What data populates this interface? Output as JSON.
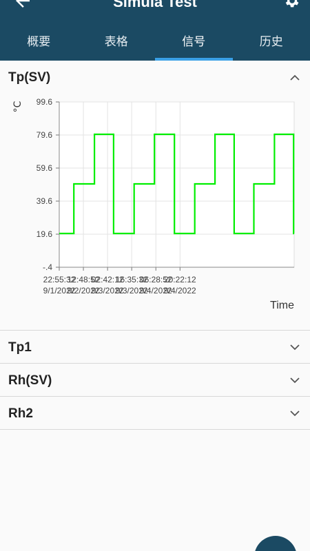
{
  "app": {
    "title": "Simula Test"
  },
  "tabs": [
    {
      "label": "概要",
      "active": false
    },
    {
      "label": "表格",
      "active": false
    },
    {
      "label": "信号",
      "active": true
    },
    {
      "label": "历史",
      "active": false
    }
  ],
  "sections": [
    {
      "title": "Tp(SV)",
      "expanded": true
    },
    {
      "title": "Tp1",
      "expanded": false
    },
    {
      "title": "Rh(SV)",
      "expanded": false
    },
    {
      "title": "Rh2",
      "expanded": false
    }
  ],
  "colors": {
    "appbar": "#1b4a63",
    "tab_indicator": "#3aa0e6",
    "line": "#00ee00"
  },
  "chart_data": {
    "type": "line",
    "ylabel": "°C",
    "xlabel": "Time",
    "y_ticks": [
      "99.6",
      "79.6",
      "59.6",
      "39.6",
      "19.6",
      "-.4"
    ],
    "ylim": [
      -0.4,
      99.6
    ],
    "x_ticks": [
      {
        "time": "22:55:32",
        "date": "9/1/2022"
      },
      {
        "time": "12:48:52",
        "date": "9/2/2022"
      },
      {
        "time": "02:42:12",
        "date": "9/3/2022"
      },
      {
        "time": "16:35:32",
        "date": "9/3/2022"
      },
      {
        "time": "06:28:52",
        "date": "9/4/2022"
      },
      {
        "time": "20:22:12",
        "date": "9/4/2022"
      }
    ],
    "series": [
      {
        "color": "#00ee00",
        "points": [
          [
            "2022-09-01 22:55",
            20
          ],
          [
            "2022-09-02 07:20",
            20
          ],
          [
            "2022-09-02 07:20",
            50
          ],
          [
            "2022-09-02 19:10",
            50
          ],
          [
            "2022-09-02 19:10",
            80
          ],
          [
            "2022-09-03 06:10",
            80
          ],
          [
            "2022-09-03 06:10",
            20
          ],
          [
            "2022-09-03 18:00",
            20
          ],
          [
            "2022-09-03 18:00",
            50
          ],
          [
            "2022-09-04 05:40",
            50
          ],
          [
            "2022-09-04 05:40",
            80
          ],
          [
            "2022-09-04 17:10",
            80
          ],
          [
            "2022-09-04 17:10",
            20
          ],
          [
            "2022-09-05 04:50",
            20
          ],
          [
            "2022-09-05 04:50",
            50
          ],
          [
            "2022-09-05 16:30",
            50
          ],
          [
            "2022-09-05 16:30",
            80
          ],
          [
            "2022-09-06 03:30",
            80
          ],
          [
            "2022-09-06 03:30",
            20
          ],
          [
            "2022-09-06 14:50",
            20
          ],
          [
            "2022-09-06 14:50",
            50
          ],
          [
            "2022-09-07 02:40",
            50
          ],
          [
            "2022-09-07 02:40",
            80
          ],
          [
            "2022-09-07 13:40",
            80
          ],
          [
            "2022-09-07 13:40",
            20
          ],
          [
            "2022-09-07 14:00",
            20
          ]
        ]
      }
    ]
  }
}
